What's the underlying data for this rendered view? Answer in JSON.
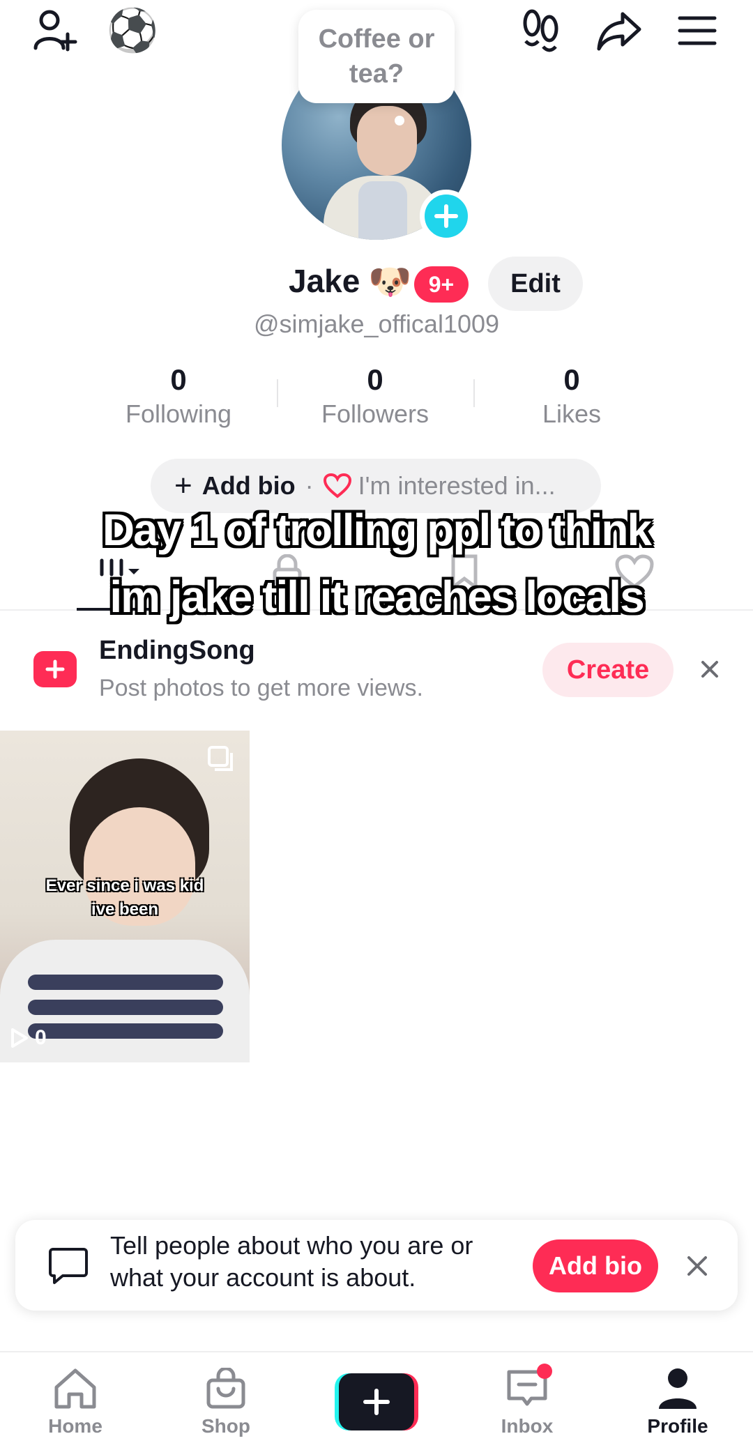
{
  "bubble": {
    "text": "Coffee or tea?"
  },
  "profile": {
    "name": "Jake",
    "name_emoji": "🐶",
    "badge": "9+",
    "edit_label": "Edit",
    "handle": "@simjake_offical1009"
  },
  "stats": [
    {
      "value": "0",
      "label": "Following"
    },
    {
      "value": "0",
      "label": "Followers"
    },
    {
      "value": "0",
      "label": "Likes"
    }
  ],
  "bio_pill": {
    "plus": "+",
    "add_bio": "Add bio",
    "separator": "·",
    "interest": "I'm interested in..."
  },
  "caption": {
    "line1": "Day 1 of trolling ppl to think",
    "line2": "im jake till it reaches locals"
  },
  "song_banner": {
    "title": "EndingSong",
    "subtitle": "Post photos to get more views.",
    "create_label": "Create"
  },
  "videos": [
    {
      "caption_line1": "Ever since i was kid",
      "caption_line2": "ive been",
      "views": "0"
    }
  ],
  "bio_card": {
    "text": "Tell people about who you are or what your account is about.",
    "button_label": "Add bio"
  },
  "nav": {
    "home": "Home",
    "shop": "Shop",
    "inbox": "Inbox",
    "profile": "Profile"
  },
  "icons": {
    "top_left": "add-user-icon",
    "soccer": "⚽",
    "top_right": [
      "footsteps-icon",
      "share-icon",
      "menu-icon"
    ]
  },
  "colors": {
    "accent": "#fe2c55",
    "teal": "#20d5ec",
    "muted_text": "#8a8b91"
  }
}
